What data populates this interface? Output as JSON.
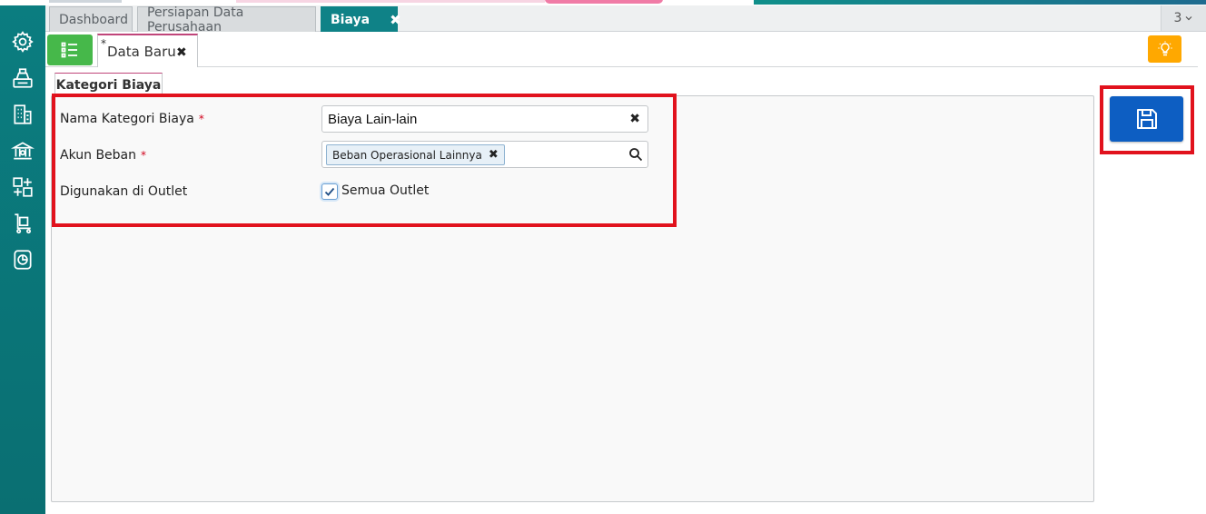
{
  "tabs": {
    "items": [
      {
        "label": "Dashboard"
      },
      {
        "label": "Persiapan Data Perusahaan"
      },
      {
        "label": "Biaya"
      }
    ],
    "active_close": "✖",
    "count": "3"
  },
  "document_tab": {
    "dirty_marker": "*",
    "title": "Data Baru",
    "close": "✖"
  },
  "section_tab": {
    "label": "Kategori Biaya"
  },
  "form": {
    "required_marker": "*",
    "fields": [
      {
        "label": "Nama Kategori Biaya",
        "value": "Biaya Lain-lain",
        "clear": "✖"
      },
      {
        "label": "Akun Beban",
        "chip": "Beban Operasional Lainnya",
        "chip_remove": "✖"
      },
      {
        "label": "Digunakan di Outlet",
        "checkbox_label": "Semua Outlet",
        "checked": true
      }
    ]
  },
  "colors": {
    "sidebar": "#0b7d80",
    "active_tab": "#0f8287",
    "menu_button": "#46b84a",
    "bulb_button": "#ffa800",
    "save_button": "#0d5ec2",
    "highlight": "#e1121d",
    "required": "#d0021b"
  },
  "icons": {
    "sidebar": [
      "gear-icon",
      "cash-register-icon",
      "building-icon",
      "bank-icon",
      "inventory-icon",
      "trolley-icon",
      "report-icon"
    ],
    "menu": "list-icon",
    "bulb": "lightbulb-icon",
    "save": "floppy-disk-icon",
    "search": "search-icon",
    "dropdown": "chevron-down-icon"
  }
}
